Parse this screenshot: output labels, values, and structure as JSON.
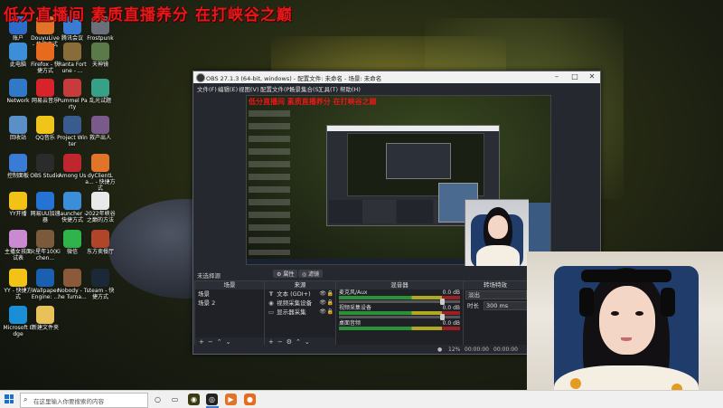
{
  "overlay": {
    "title": "低分直播间 素质直播养分 在打峡谷之巅"
  },
  "desktop_icons": [
    {
      "label": "账户",
      "icon": "user-account-icon",
      "color": "#2d6cc9"
    },
    {
      "label": "DouyuLive - 快捷方式",
      "icon": "douyu-live-icon",
      "color": "#e2742a"
    },
    {
      "label": "腾讯会议",
      "icon": "tencent-meeting-icon",
      "color": "#3a7bd5"
    },
    {
      "label": "Frostpunk",
      "icon": "frostpunk-icon",
      "color": "#6b6f7a"
    },
    {
      "label": "此电脑",
      "icon": "this-pc-icon",
      "color": "#3d8ed8"
    },
    {
      "label": "Firefox - 快捷方式",
      "icon": "firefox-icon",
      "color": "#e86a1c"
    },
    {
      "label": "Ranta Fortune - ...",
      "icon": "ranta-fortune-icon",
      "color": "#8a6b3a"
    },
    {
      "label": "天神镜",
      "icon": "tianshenjing-icon",
      "color": "#5a7a4a"
    },
    {
      "label": "Network",
      "icon": "network-icon",
      "color": "#2f79c8"
    },
    {
      "label": "网易云音乐",
      "icon": "netease-music-icon",
      "color": "#d8232a"
    },
    {
      "label": "Pummel Party",
      "icon": "pummel-party-icon",
      "color": "#c63b3b"
    },
    {
      "label": "乱光试题",
      "icon": "tpm-icon",
      "color": "#36a186"
    },
    {
      "label": "回收站",
      "icon": "recycle-bin-icon",
      "color": "#5a8fc8"
    },
    {
      "label": "QQ音乐",
      "icon": "qq-music-icon",
      "color": "#f0c419"
    },
    {
      "label": "Project Winter",
      "icon": "project-winter-icon",
      "color": "#3a5b8e"
    },
    {
      "label": "救产出人",
      "icon": "game-shortcut-icon",
      "color": "#7a5a8a"
    },
    {
      "label": "控制面板",
      "icon": "control-panel-icon",
      "color": "#3a7bd5"
    },
    {
      "label": "OBS Studio",
      "icon": "obs-studio-icon",
      "color": "#2b2b2b"
    },
    {
      "label": "Among Us",
      "icon": "among-us-icon",
      "color": "#c0262d"
    },
    {
      "label": "dyClientLa... - 快捷方式",
      "icon": "douyu-client-icon",
      "color": "#e2742a"
    },
    {
      "label": "YY开播",
      "icon": "yy-live-icon",
      "color": "#f2c316"
    },
    {
      "label": "网易UU加速器",
      "icon": "uu-accelerator-icon",
      "color": "#2673d6"
    },
    {
      "label": "launcher - 快捷方式",
      "icon": "launcher-icon",
      "color": "#3d8ed8"
    },
    {
      "label": "2022年峡谷之巅的方法",
      "icon": "document-icon",
      "color": "#e9e9e9"
    },
    {
      "label": "主播女孩面试表",
      "icon": "image-file-icon",
      "color": "#c98ad1"
    },
    {
      "label": "火星年10(Kichen...",
      "icon": "game-shortcut-icon",
      "color": "#7a5a3a"
    },
    {
      "label": "微信",
      "icon": "wechat-icon",
      "color": "#2fb34a"
    },
    {
      "label": "东方卖餐厅",
      "icon": "game-shortcut-icon",
      "color": "#b0452a"
    },
    {
      "label": "YY - 快捷方式",
      "icon": "yy-icon",
      "color": "#f2c316"
    },
    {
      "label": "Wallpaper Engine: ...",
      "icon": "wallpaper-engine-icon",
      "color": "#1b5fb0"
    },
    {
      "label": "Nobody - The Turna...",
      "icon": "nobody-game-icon",
      "color": "#8a5a3a"
    },
    {
      "label": "steam - 快捷方式",
      "icon": "steam-icon",
      "color": "#1b2838"
    },
    {
      "label": "Microsoft Edge",
      "icon": "edge-icon",
      "color": "#1a8fd6"
    },
    {
      "label": "新建文件夹",
      "icon": "folder-icon",
      "color": "#e8c15a"
    }
  ],
  "obs": {
    "title": "OBS 27.1.3 (64-bit, windows) - 配置文件: 未命名 - 场景: 未命名",
    "menu": [
      "文件(F)",
      "编辑(E)",
      "视图(V)",
      "配置文件(P)",
      "场景集合(S)",
      "工具(T)",
      "帮助(H)"
    ],
    "no_source_selected": "未选择源",
    "properties_btn": "属性",
    "filters_btn": "滤镜",
    "scenes_header": "场景",
    "scenes": [
      "场景",
      "场景 2"
    ],
    "sources_header": "来源",
    "sources": [
      {
        "type_icon": "T",
        "name": "文本 (GDI+)"
      },
      {
        "type_icon": "◉",
        "name": "视频采集设备"
      },
      {
        "type_icon": "▭",
        "name": "显示器采集"
      }
    ],
    "mixer_header": "混音器",
    "mixer_tracks": [
      {
        "name": "桌面音频",
        "db": "0.0 dB"
      },
      {
        "name": "视频采集设备",
        "db": "0.0 dB"
      },
      {
        "name": "麦克风/Aux",
        "db": "0.0 dB"
      }
    ],
    "transitions_header": "转场特效",
    "transition_type": "淡出",
    "duration_label": "时长",
    "duration_value": "300 ms",
    "status": {
      "fps_label": "12%",
      "time1": "00:00:00",
      "time2": "00:00:00"
    }
  },
  "preview_url": "...",
  "taskbar": {
    "search_placeholder": "在这里输入你要搜索的内容"
  }
}
